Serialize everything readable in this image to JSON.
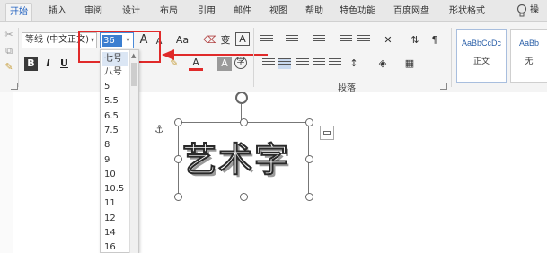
{
  "tabs": [
    "开始",
    "插入",
    "审阅",
    "设计",
    "布局",
    "引用",
    "邮件",
    "视图",
    "帮助",
    "特色功能",
    "百度网盘",
    "形状格式"
  ],
  "active_tab": "开始",
  "tell_me": "操",
  "font": {
    "name": "等线 (中文正文)",
    "size": "36",
    "grow_label": "A",
    "shrink_label": "A",
    "change_case_label": "Aa",
    "phonetic_label": "变",
    "enclose_label": "A",
    "bold_label": "B",
    "italic_label": "I",
    "underline_label": "U",
    "shade_label": "A"
  },
  "size_options": [
    "七号",
    "八号",
    "5",
    "5.5",
    "6.5",
    "7.5",
    "8",
    "9",
    "10",
    "10.5",
    "11",
    "12",
    "14",
    "16"
  ],
  "size_hover": "七号",
  "paragraph": {
    "label": "段落"
  },
  "styles": [
    {
      "sample": "AaBbCcDc",
      "name": "正文"
    },
    {
      "sample": "AaBb",
      "name": "无"
    }
  ],
  "document": {
    "word_art": "艺术字"
  },
  "colors": {
    "highlight_box": "#e02a2a",
    "selected_size": "#3b7ed0",
    "active_tab_text": "#1e5fbf"
  }
}
